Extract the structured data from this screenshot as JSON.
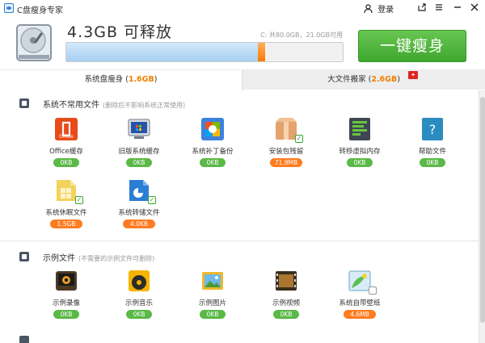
{
  "app": {
    "title": "C盘瘦身专家"
  },
  "header": {
    "login": "登录",
    "space_title": "4.3GB 可释放",
    "disk_info": "C: 共80.0GB，21.0GB可用",
    "slim_button": "一键瘦身",
    "used_fraction": 0.72,
    "release_marker_fraction": 0.05
  },
  "tabs": [
    {
      "label": "系统盘瘦身",
      "size": "1.6GB",
      "state": "active"
    },
    {
      "label": "大文件搬家",
      "size": "2.6GB",
      "state": "inactive"
    }
  ],
  "colors": {
    "accent_green": "#4cb23a",
    "accent_orange": "#ff7c21",
    "tab_size": "#f08000",
    "progress_blue": "#b8dbf7"
  },
  "sections": [
    {
      "title": "系统不常用文件",
      "note": "(删除后不影响系统正常使用)",
      "items": [
        {
          "label": "Office缓存",
          "size": "0KB",
          "icon": "office-icon",
          "checked": false
        },
        {
          "label": "旧版系统缓存",
          "size": "0KB",
          "icon": "old-system-icon",
          "checked": false
        },
        {
          "label": "系统补丁备份",
          "size": "0KB",
          "icon": "patch-backup-icon",
          "checked": false
        },
        {
          "label": "安装包残留",
          "size": "71.9MB",
          "icon": "installer-box-icon",
          "checked": true
        },
        {
          "label": "转移虚拟内存",
          "size": "0KB",
          "icon": "virtual-memory-icon",
          "checked": false
        },
        {
          "label": "帮助文件",
          "size": "0KB",
          "icon": "help-file-icon",
          "checked": false
        },
        {
          "label": "系统休眠文件",
          "size": "1.5GB",
          "icon": "hibernate-file-icon",
          "checked": true
        },
        {
          "label": "系统转储文件",
          "size": "4.0KB",
          "icon": "dump-file-icon",
          "checked": true
        }
      ]
    },
    {
      "title": "示例文件",
      "note": "(不需要的示例文件可删除)",
      "items": [
        {
          "label": "示例录像",
          "size": "0KB",
          "icon": "sample-video-icon",
          "checked": false
        },
        {
          "label": "示例音乐",
          "size": "0KB",
          "icon": "sample-music-icon",
          "checked": false
        },
        {
          "label": "示例图片",
          "size": "0KB",
          "icon": "sample-picture-icon",
          "checked": false
        },
        {
          "label": "示例视频",
          "size": "0KB",
          "icon": "sample-movie-icon",
          "checked": false
        },
        {
          "label": "系统自带壁纸",
          "size": "4.6MB",
          "icon": "wallpaper-icon",
          "checked": false
        }
      ]
    }
  ]
}
